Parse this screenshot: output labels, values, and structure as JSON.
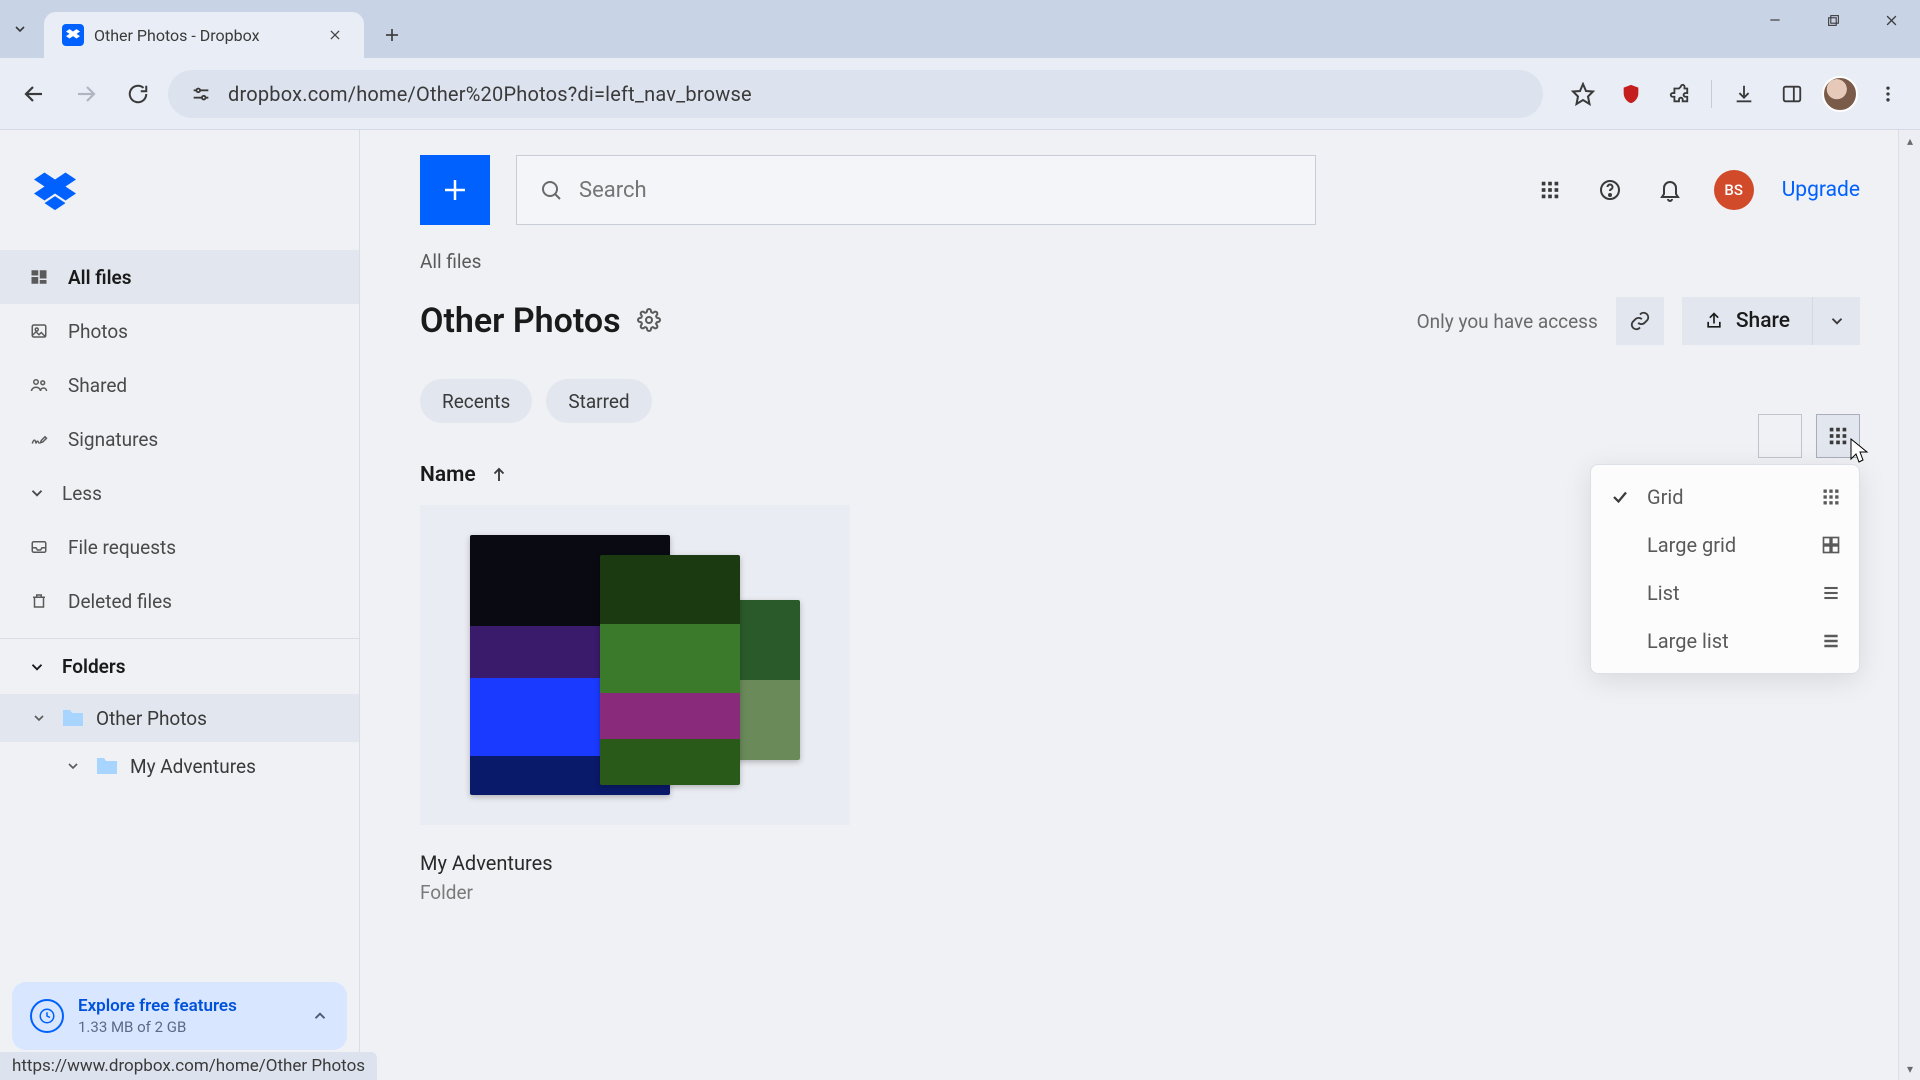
{
  "browser": {
    "tab_title": "Other Photos - Dropbox",
    "url": "dropbox.com/home/Other%20Photos?di=left_nav_browse",
    "status_bar": "https://www.dropbox.com/home/Other Photos"
  },
  "sidebar": {
    "items": [
      {
        "id": "all-files",
        "label": "All files",
        "active": true
      },
      {
        "id": "photos",
        "label": "Photos"
      },
      {
        "id": "shared",
        "label": "Shared"
      },
      {
        "id": "signatures",
        "label": "Signatures"
      }
    ],
    "less_label": "Less",
    "more_items": [
      {
        "id": "file-requests",
        "label": "File requests"
      },
      {
        "id": "deleted-files",
        "label": "Deleted files"
      }
    ],
    "folders_header": "Folders",
    "tree": [
      {
        "label": "Other Photos",
        "children": [
          {
            "label": "My Adventures"
          }
        ]
      }
    ],
    "promo": {
      "title": "Explore free features",
      "subtitle": "1.33 MB of 2 GB"
    }
  },
  "topbar": {
    "search_placeholder": "Search",
    "avatar_initials": "BS",
    "upgrade_label": "Upgrade"
  },
  "page": {
    "breadcrumb": "All files",
    "title": "Other Photos",
    "access_text": "Only you have access",
    "share_label": "Share",
    "chips": [
      "Recents",
      "Starred"
    ],
    "column_header": "Name",
    "sort_direction": "asc"
  },
  "view_menu": {
    "selected": "Grid",
    "options": [
      {
        "id": "grid",
        "label": "Grid"
      },
      {
        "id": "large-grid",
        "label": "Large grid"
      },
      {
        "id": "list",
        "label": "List"
      },
      {
        "id": "large-list",
        "label": "Large list"
      }
    ]
  },
  "items": [
    {
      "name": "My Adventures",
      "type": "Folder"
    }
  ]
}
